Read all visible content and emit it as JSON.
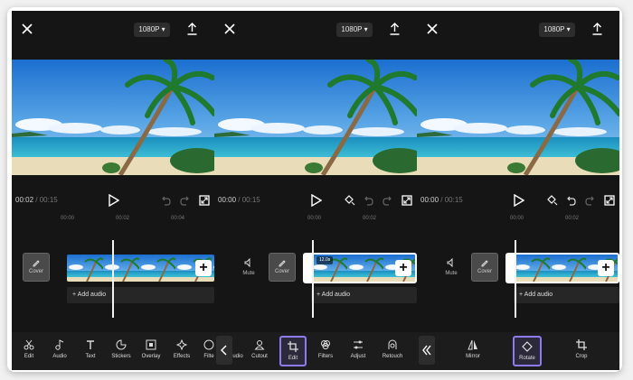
{
  "resolution": "1080P",
  "panel1": {
    "time_current": "00:02",
    "time_sep": " / ",
    "time_total": "00:15",
    "ruler": [
      "00:00",
      "00:02",
      "00:04"
    ],
    "cover_label": "Cover",
    "add_audio": "+ Add audio",
    "tools": [
      "Edit",
      "Audio",
      "Text",
      "Stickers",
      "Overlay",
      "Effects",
      "Filte"
    ]
  },
  "panel2": {
    "time_current": "00:00",
    "time_sep": " / ",
    "time_total": "00:15",
    "ruler": [
      "00:00",
      "00:02"
    ],
    "mute_label": "Mute",
    "cover_label": "Cover",
    "clip_duration": "12.0s",
    "add_audio": "+ Add audio",
    "tools": [
      "udio",
      "Cutout",
      "Edit",
      "Filters",
      "Adjust",
      "Retouch"
    ],
    "highlighted_tool": "Edit"
  },
  "panel3": {
    "time_current": "00:00",
    "time_sep": " / ",
    "time_total": "00:15",
    "ruler": [
      "00:00",
      "00:02"
    ],
    "mute_label": "Mute",
    "cover_label": "Cover",
    "add_audio": "+ Add audio",
    "tools": [
      "Mirror",
      "Rotate",
      "Crop"
    ],
    "highlighted_tool": "Rotate"
  },
  "colors": {
    "highlight": "#8e7bf0",
    "background": "#151515"
  }
}
